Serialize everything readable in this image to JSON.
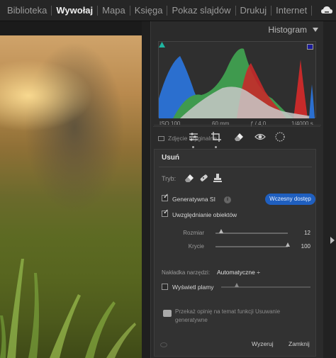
{
  "topbar": {
    "modules": [
      {
        "label": "Biblioteka",
        "active": false
      },
      {
        "label": "Wywołaj",
        "active": true
      },
      {
        "label": "Mapa",
        "active": false
      },
      {
        "label": "Księga",
        "active": false
      },
      {
        "label": "Pokaz slajdów",
        "active": false
      },
      {
        "label": "Drukuj",
        "active": false
      },
      {
        "label": "Internet",
        "active": false
      }
    ],
    "sync_icon": "cloud-sync-icon"
  },
  "histogram": {
    "title": "Histogram",
    "iso": "ISO 100",
    "focal": "60 mm",
    "aperture": "ƒ / 4,0",
    "shutter": "1/4000 s",
    "original_photo": "Zdjęcie oryginalne"
  },
  "tools": [
    "sliders-icon",
    "crop-icon",
    "eraser-icon",
    "redeye-icon",
    "mask-icon"
  ],
  "remove_panel": {
    "title": "Usuń",
    "mode_label": "Tryb:",
    "generative_label": "Generatywna SI",
    "generative_checked": true,
    "early_access": "Wczesny dostęp",
    "objects_label": "Uwzględnianie obiektów",
    "objects_checked": true,
    "size_label": "Rozmiar",
    "size_value": "12",
    "size_fraction": 0.08,
    "opacity_label": "Krycie",
    "opacity_value": "100",
    "opacity_fraction": 1.0,
    "overlay_label": "Nakładka narzędzi:",
    "overlay_value": "Automatyczne ÷",
    "show_spots_label": "Wyświetl plamy",
    "show_spots_checked": false,
    "feedback_text": "Przekaż opinię na temat funkcji Usuwanie generatywne",
    "reset_label": "Wyzeruj",
    "close_label": "Zamknij"
  },
  "colors": {
    "accent": "#1f5fbf",
    "panel": "#2b2b2b",
    "hist_blue": "#2b6fcf",
    "hist_green": "#3f9a4e",
    "hist_red": "#c62a2a"
  }
}
